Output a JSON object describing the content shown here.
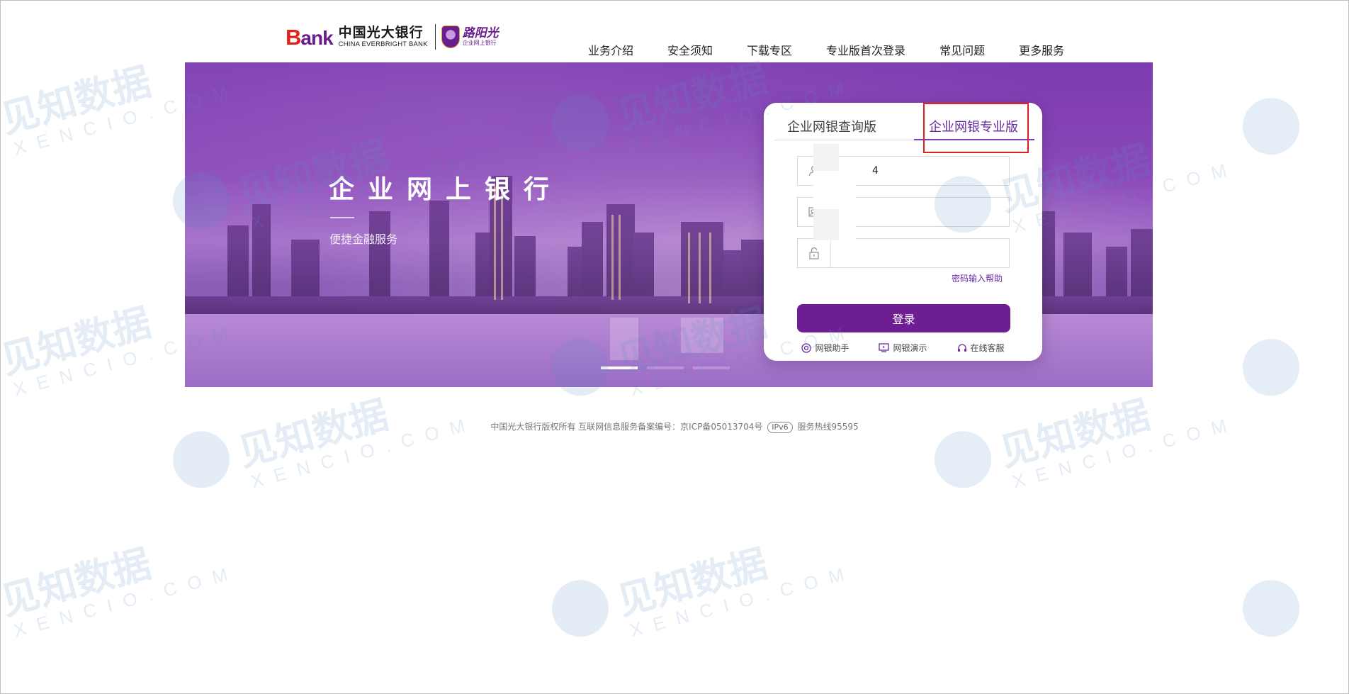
{
  "header": {
    "logo": {
      "bank_b": "B",
      "bank_rest": "ank",
      "name_cn": "中国光大银行",
      "name_en": "CHINA EVERBRIGHT BANK",
      "badge_title": "路阳光",
      "badge_sub": "企业网上银行"
    },
    "nav": [
      "业务介绍",
      "安全须知",
      "下载专区",
      "专业版首次登录",
      "常见问题",
      "更多服务"
    ]
  },
  "banner": {
    "title": "企业网上银行",
    "subtitle": "便捷金融服务",
    "slides_total": 3,
    "active_slide": 1
  },
  "login": {
    "tabs": [
      {
        "label": "企业网银查询版",
        "active": false
      },
      {
        "label": "企业网银专业版",
        "active": true
      }
    ],
    "username_value": "4",
    "certificate_value": "",
    "password_value": "",
    "password_help": "密码输入帮助",
    "login_button": "登录",
    "bottom_links": [
      {
        "label": "网银助手",
        "icon": "assistant-icon"
      },
      {
        "label": "网银演示",
        "icon": "demo-icon"
      },
      {
        "label": "在线客服",
        "icon": "headset-icon"
      }
    ]
  },
  "footer": {
    "text_before": "中国光大银行版权所有 互联网信息服务备案编号：京ICP备05013704号",
    "ipv6": "IPv6",
    "text_after": "服务热线95595"
  },
  "watermark": {
    "cn": "见知数据",
    "en": "XENCIO.COM"
  },
  "colors": {
    "brand_purple": "#6d1e92",
    "accent_purple": "#7b3bb7",
    "logo_red": "#e2231a",
    "highlight_red": "#e02020"
  }
}
